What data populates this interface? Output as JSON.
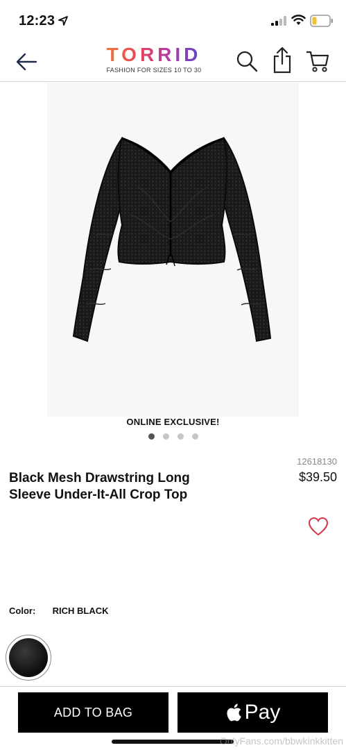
{
  "status_bar": {
    "time": "12:23"
  },
  "header": {
    "logo_word": "TORRID",
    "logo_tagline": "FASHION FOR SIZES 10 TO 30",
    "icons": [
      "back-arrow-icon",
      "search-icon",
      "share-icon",
      "cart-icon"
    ]
  },
  "product": {
    "badge": "ONLINE EXCLUSIVE!",
    "image_count": 4,
    "active_image": 1,
    "sku": "12618130",
    "title": "Black Mesh Drawstring Long Sleeve Under-It-All Crop Top",
    "price": "$39.50",
    "color_label": "Color:",
    "color_value": "RICH BLACK"
  },
  "actions": {
    "add_to_bag": "ADD TO BAG",
    "pay_label": "Pay"
  },
  "watermark": "OnlyFans.com/bbwkinkkitten",
  "colors": {
    "brand_gradient": [
      "#f0793a",
      "#e8435b",
      "#b43aa6",
      "#5a47c8"
    ],
    "button_bg": "#000000",
    "heart": "#d6364a"
  }
}
